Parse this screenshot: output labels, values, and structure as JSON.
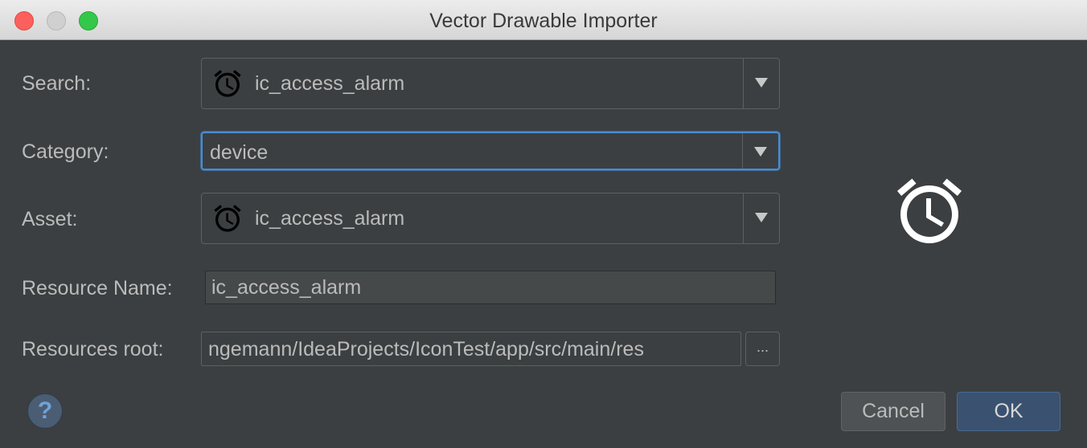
{
  "window": {
    "title": "Vector Drawable Importer"
  },
  "form": {
    "search": {
      "label": "Search:",
      "value": "ic_access_alarm",
      "icon": "alarm-icon"
    },
    "category": {
      "label": "Category:",
      "value": "device"
    },
    "asset": {
      "label": "Asset:",
      "value": "ic_access_alarm",
      "icon": "alarm-icon"
    },
    "resource_name": {
      "label": "Resource Name:",
      "value": "ic_access_alarm"
    },
    "resources_root": {
      "label": "Resources root:",
      "value": "ngemann/IdeaProjects/IconTest/app/src/main/res",
      "browse_label": "..."
    }
  },
  "preview": {
    "icon": "alarm-icon"
  },
  "buttons": {
    "help": "?",
    "cancel": "Cancel",
    "ok": "OK"
  },
  "colors": {
    "background": "#3c3f41",
    "focus": "#4a8bd0",
    "ok_button": "#3a5270"
  }
}
